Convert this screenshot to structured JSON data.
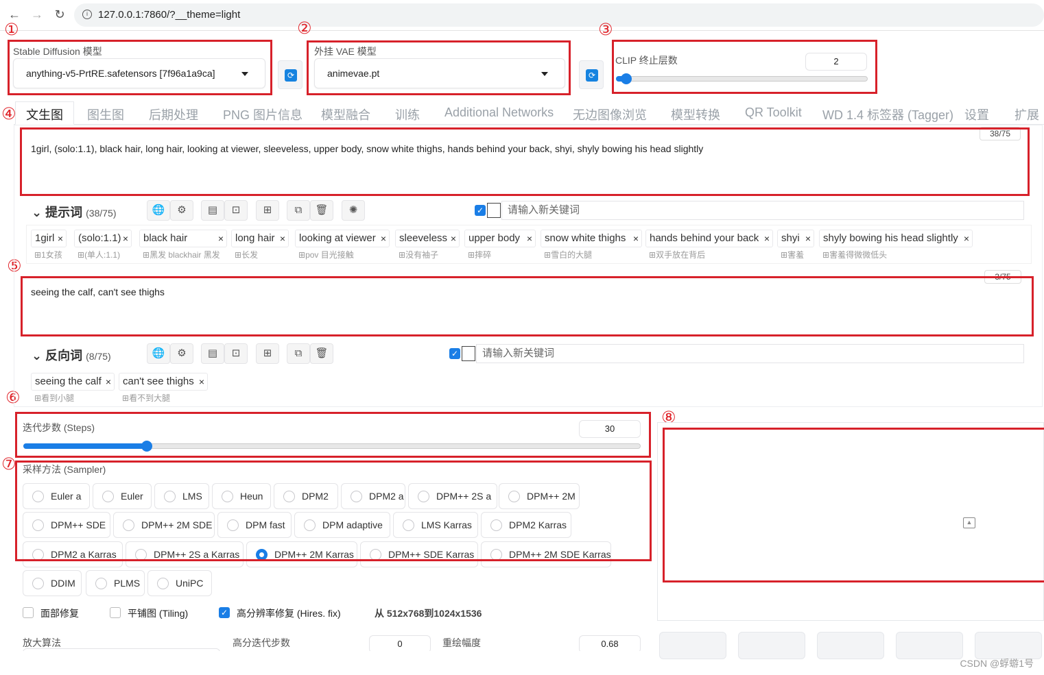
{
  "browser": {
    "url": "127.0.0.1:7860/?__theme=light"
  },
  "markers": [
    "①",
    "②",
    "③",
    "④",
    "⑤",
    "⑥",
    "⑦",
    "⑧"
  ],
  "model": {
    "label": "Stable Diffusion 模型",
    "value": "anything-v5-PrtRE.safetensors [7f96a1a9ca]"
  },
  "vae": {
    "label": "外挂 VAE 模型",
    "value": "animevae.pt"
  },
  "clip": {
    "label": "CLIP 终止层数",
    "value": "2",
    "fraction": 0.04
  },
  "tabs": [
    "文生图",
    "图生图",
    "后期处理",
    "PNG 图片信息",
    "模型融合",
    "训练",
    "Additional Networks",
    "无边图像浏览",
    "模型转换",
    "QR Toolkit",
    "WD 1.4 标签器 (Tagger)",
    "设置",
    "扩展"
  ],
  "prompt": {
    "text": "1girl, (solo:1.1), black hair, long hair, looking at viewer, sleeveless, upper body, snow white thighs, hands behind your back, shyi, shyly bowing his head slightly",
    "counter": "38/75",
    "title": "提示词",
    "count": "(38/75)",
    "kw_placeholder": "请输入新关键词",
    "tags": [
      {
        "en": "1girl",
        "zh": "1女孩"
      },
      {
        "en": "(solo:1.1)",
        "zh": "(单人:1.1)"
      },
      {
        "en": "black hair",
        "zh": "黑发 blackhair 黑发"
      },
      {
        "en": "long hair",
        "zh": "长发"
      },
      {
        "en": "looking at viewer",
        "zh": "pov 目光接触"
      },
      {
        "en": "sleeveless",
        "zh": "没有袖子"
      },
      {
        "en": "upper body",
        "zh": "摔碎"
      },
      {
        "en": "snow white thighs",
        "zh": "雪白的大腿"
      },
      {
        "en": "hands behind your back",
        "zh": "双手放在背后"
      },
      {
        "en": "shyi",
        "zh": "害羞"
      },
      {
        "en": "shyly bowing his head slightly",
        "zh": "害羞得微微低头"
      }
    ]
  },
  "negative": {
    "text": "seeing the calf, can't see thighs",
    "counter": "3/75",
    "title": "反向词",
    "count": "(8/75)",
    "kw_placeholder": "请输入新关键词",
    "tags": [
      {
        "en": "seeing the calf",
        "zh": "看到小腿"
      },
      {
        "en": "can't see thighs",
        "zh": "看不到大腿"
      }
    ]
  },
  "steps": {
    "label": "迭代步数 (Steps)",
    "value": "30",
    "fraction": 0.2
  },
  "sampler": {
    "label": "采样方法 (Sampler)",
    "options": [
      "Euler a",
      "Euler",
      "LMS",
      "Heun",
      "DPM2",
      "DPM2 a",
      "DPM++ 2S a",
      "DPM++ 2M",
      "DPM++ SDE",
      "DPM++ 2M SDE",
      "DPM fast",
      "DPM adaptive",
      "LMS Karras",
      "DPM2 Karras",
      "DPM2 a Karras",
      "DPM++ 2S a Karras",
      "DPM++ 2M Karras",
      "DPM++ SDE Karras",
      "DPM++ 2M SDE Karras",
      "DDIM",
      "PLMS",
      "UniPC"
    ],
    "selected": "DPM++ 2M Karras"
  },
  "options": {
    "face": "面部修复",
    "tiling": "平铺图 (Tiling)",
    "hires": "高分辨率修复 (Hires. fix)",
    "hires_info": "从 512x768到1024x1536"
  },
  "hires": {
    "upscaler_label": "放大算法",
    "steps_label": "高分迭代步数",
    "steps_value": "0",
    "denoise_label": "重绘幅度",
    "denoise_value": "0.68"
  },
  "watermark": "CSDN @蜉蝣1号"
}
